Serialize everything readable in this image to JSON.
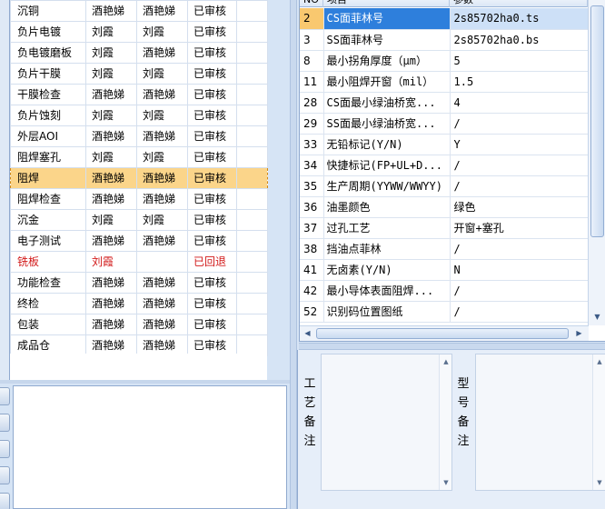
{
  "process_table": {
    "rows": [
      {
        "process": "沉铜",
        "operator": "酒艳娣",
        "reviewer": "酒艳娣",
        "status": "已审核",
        "state": "normal"
      },
      {
        "process": "负片电镀",
        "operator": "刘霞",
        "reviewer": "刘霞",
        "status": "已审核",
        "state": "normal"
      },
      {
        "process": "负电镀磨板",
        "operator": "刘霞",
        "reviewer": "酒艳娣",
        "status": "已审核",
        "state": "normal"
      },
      {
        "process": "负片干膜",
        "operator": "刘霞",
        "reviewer": "刘霞",
        "status": "已审核",
        "state": "normal"
      },
      {
        "process": "干膜检查",
        "operator": "酒艳娣",
        "reviewer": "酒艳娣",
        "status": "已审核",
        "state": "normal"
      },
      {
        "process": "负片蚀刻",
        "operator": "刘霞",
        "reviewer": "刘霞",
        "status": "已审核",
        "state": "normal"
      },
      {
        "process": "外层AOI",
        "operator": "酒艳娣",
        "reviewer": "酒艳娣",
        "status": "已审核",
        "state": "normal"
      },
      {
        "process": "阻焊塞孔",
        "operator": "刘霞",
        "reviewer": "刘霞",
        "status": "已审核",
        "state": "normal"
      },
      {
        "process": "阻焊",
        "operator": "酒艳娣",
        "reviewer": "酒艳娣",
        "status": "已审核",
        "state": "selected"
      },
      {
        "process": "阻焊检查",
        "operator": "酒艳娣",
        "reviewer": "酒艳娣",
        "status": "已审核",
        "state": "normal"
      },
      {
        "process": "沉金",
        "operator": "刘霞",
        "reviewer": "刘霞",
        "status": "已审核",
        "state": "normal"
      },
      {
        "process": "电子测试",
        "operator": "酒艳娣",
        "reviewer": "酒艳娣",
        "status": "已审核",
        "state": "normal"
      },
      {
        "process": "铣板",
        "operator": "刘霞",
        "reviewer": "",
        "status": "已回退",
        "state": "returned"
      },
      {
        "process": "功能检查",
        "operator": "酒艳娣",
        "reviewer": "酒艳娣",
        "status": "已审核",
        "state": "normal"
      },
      {
        "process": "终检",
        "operator": "酒艳娣",
        "reviewer": "酒艳娣",
        "status": "已审核",
        "state": "normal"
      },
      {
        "process": "包装",
        "operator": "酒艳娣",
        "reviewer": "酒艳娣",
        "status": "已审核",
        "state": "normal"
      },
      {
        "process": "成品仓",
        "operator": "酒艳娣",
        "reviewer": "酒艳娣",
        "status": "已审核",
        "state": "normal"
      }
    ]
  },
  "param_grid": {
    "headers": {
      "no": "NO",
      "item": "项目",
      "param": "参数"
    },
    "rows": [
      {
        "no": "2",
        "item": "CS面菲林号",
        "param": "2s85702ha0.ts",
        "selected": true
      },
      {
        "no": "3",
        "item": "SS面菲林号",
        "param": "2s85702ha0.bs",
        "selected": false
      },
      {
        "no": "8",
        "item": "最小拐角厚度（μm）",
        "param": "5",
        "selected": false
      },
      {
        "no": "11",
        "item": "最小阻焊开窗（mil）",
        "param": "1.5",
        "selected": false
      },
      {
        "no": "28",
        "item": "CS面最小绿油桥宽...",
        "param": "4",
        "selected": false
      },
      {
        "no": "29",
        "item": "SS面最小绿油桥宽...",
        "param": "/",
        "selected": false
      },
      {
        "no": "33",
        "item": "无铅标记(Y/N)",
        "param": "Y",
        "selected": false
      },
      {
        "no": "34",
        "item": "快捷标记(FP+UL+D...",
        "param": "/",
        "selected": false
      },
      {
        "no": "35",
        "item": "生产周期(YYWW/WWYY)",
        "param": "/",
        "selected": false
      },
      {
        "no": "36",
        "item": "油墨颜色",
        "param": "绿色",
        "selected": false
      },
      {
        "no": "37",
        "item": "过孔工艺",
        "param": "开窗+塞孔",
        "selected": false
      },
      {
        "no": "38",
        "item": "挡油点菲林",
        "param": "/",
        "selected": false
      },
      {
        "no": "41",
        "item": "无卤素(Y/N)",
        "param": "N",
        "selected": false
      },
      {
        "no": "42",
        "item": "最小导体表面阻焊...",
        "param": "/",
        "selected": false
      },
      {
        "no": "52",
        "item": "识别码位置图纸",
        "param": "/",
        "selected": false
      }
    ]
  },
  "notes": {
    "process_note_label": "工艺备注",
    "model_note_label": "型号备注"
  }
}
